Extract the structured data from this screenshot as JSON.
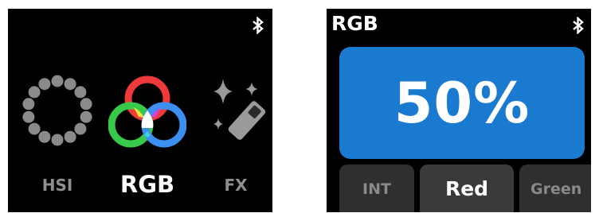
{
  "mode_screen": {
    "modes": [
      {
        "label": "HSI",
        "icon": "hsi-dots-icon",
        "active": false
      },
      {
        "label": "RGB",
        "icon": "rgb-circles-icon",
        "active": true
      },
      {
        "label": "FX",
        "icon": "fx-sparkle-icon",
        "active": false
      }
    ],
    "status_icon": "bluetooth-icon"
  },
  "rgb_screen": {
    "title": "RGB",
    "value": "50%",
    "status_icon": "bluetooth-icon",
    "value_color": "#1a7ad0",
    "tabs": [
      {
        "label": "INT",
        "active": false
      },
      {
        "label": "Red",
        "active": true
      },
      {
        "label": "Green",
        "active": false
      }
    ]
  }
}
